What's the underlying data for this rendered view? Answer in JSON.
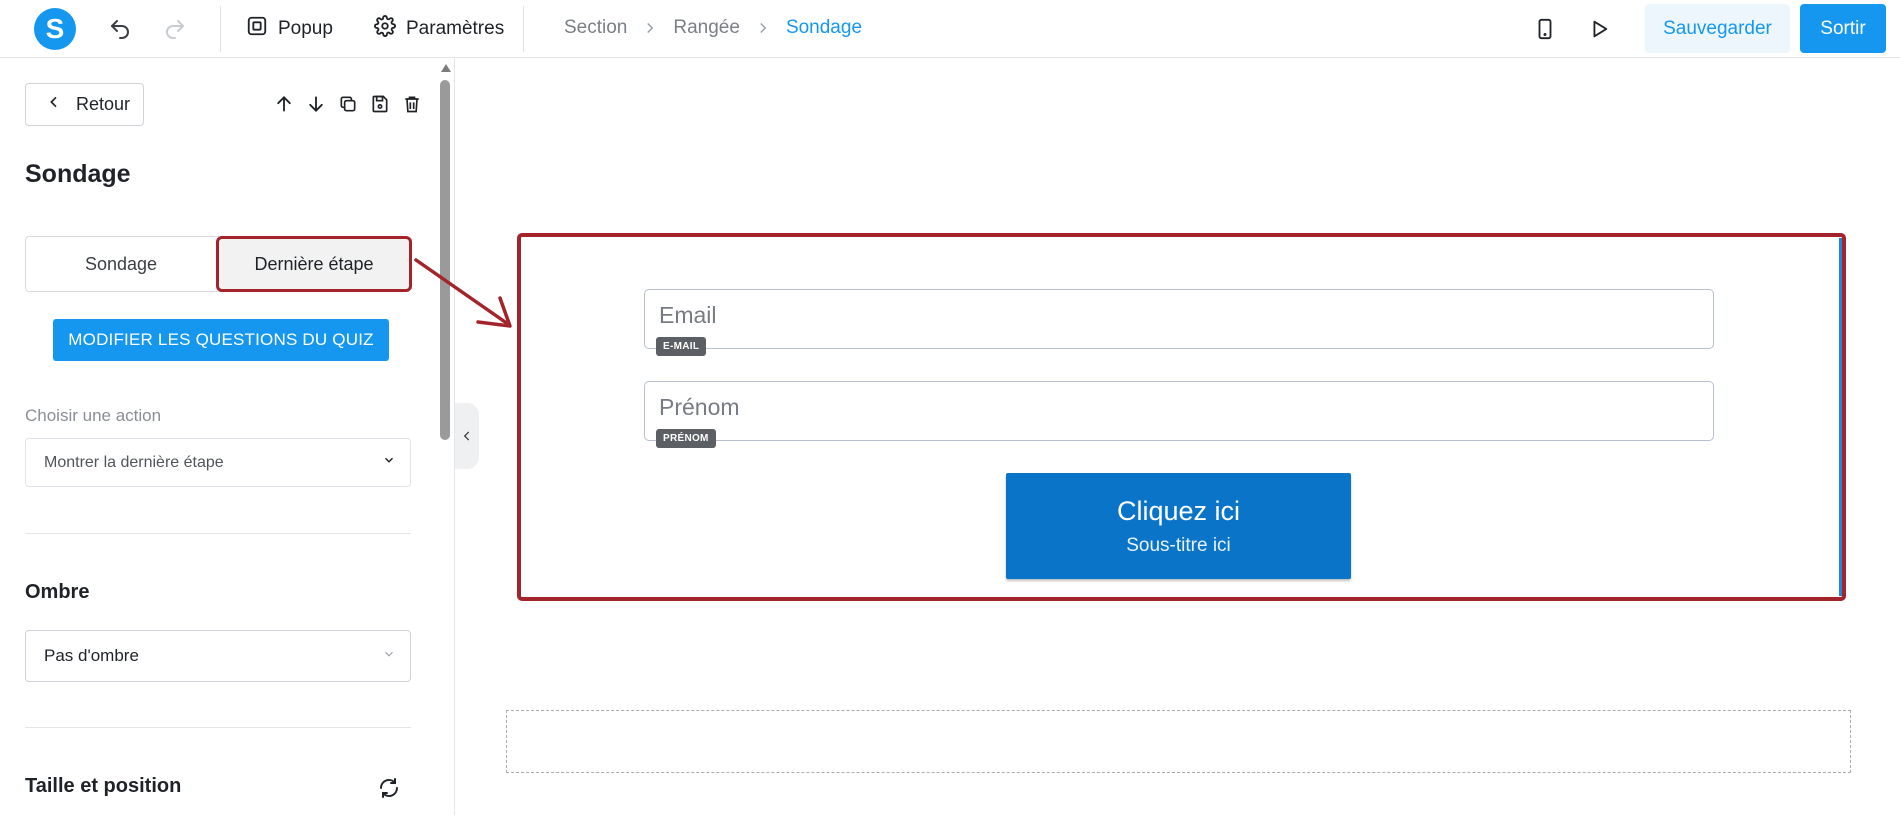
{
  "topbar": {
    "logo_letter": "S",
    "popup_label": "Popup",
    "settings_label": "Paramètres",
    "breadcrumb": [
      "Section",
      "Rangée",
      "Sondage"
    ],
    "save_label": "Sauvegarder",
    "exit_label": "Sortir"
  },
  "sidebar": {
    "back_label": "Retour",
    "title": "Sondage",
    "tabs": [
      {
        "label": "Sondage",
        "selected": false
      },
      {
        "label": "Dernière étape",
        "selected": true
      }
    ],
    "quiz_button_label": "MODIFIER LES QUESTIONS DU QUIZ",
    "action_label": "Choisir une action",
    "action_value": "Montrer la dernière étape",
    "shadow_title": "Ombre",
    "shadow_value": "Pas d'ombre",
    "size_position_title": "Taille et position"
  },
  "canvas": {
    "fields": [
      {
        "placeholder": "Email",
        "badge": "E-MAIL"
      },
      {
        "placeholder": "Prénom",
        "badge": "PRÉNOM"
      }
    ],
    "cta": {
      "title": "Cliquez ici",
      "subtitle": "Sous-titre ici"
    }
  },
  "colors": {
    "accent": "#1597f0",
    "highlight_border": "#a3242b",
    "cta_bg": "#0a74c8"
  },
  "icons": [
    "undo-icon",
    "redo-icon",
    "popup-icon",
    "gear-icon",
    "mobile-icon",
    "play-icon",
    "arrow-up-icon",
    "arrow-down-icon",
    "copy-icon",
    "save-icon",
    "trash-icon",
    "chevron-left-icon",
    "chevron-down-icon",
    "refresh-icon"
  ]
}
